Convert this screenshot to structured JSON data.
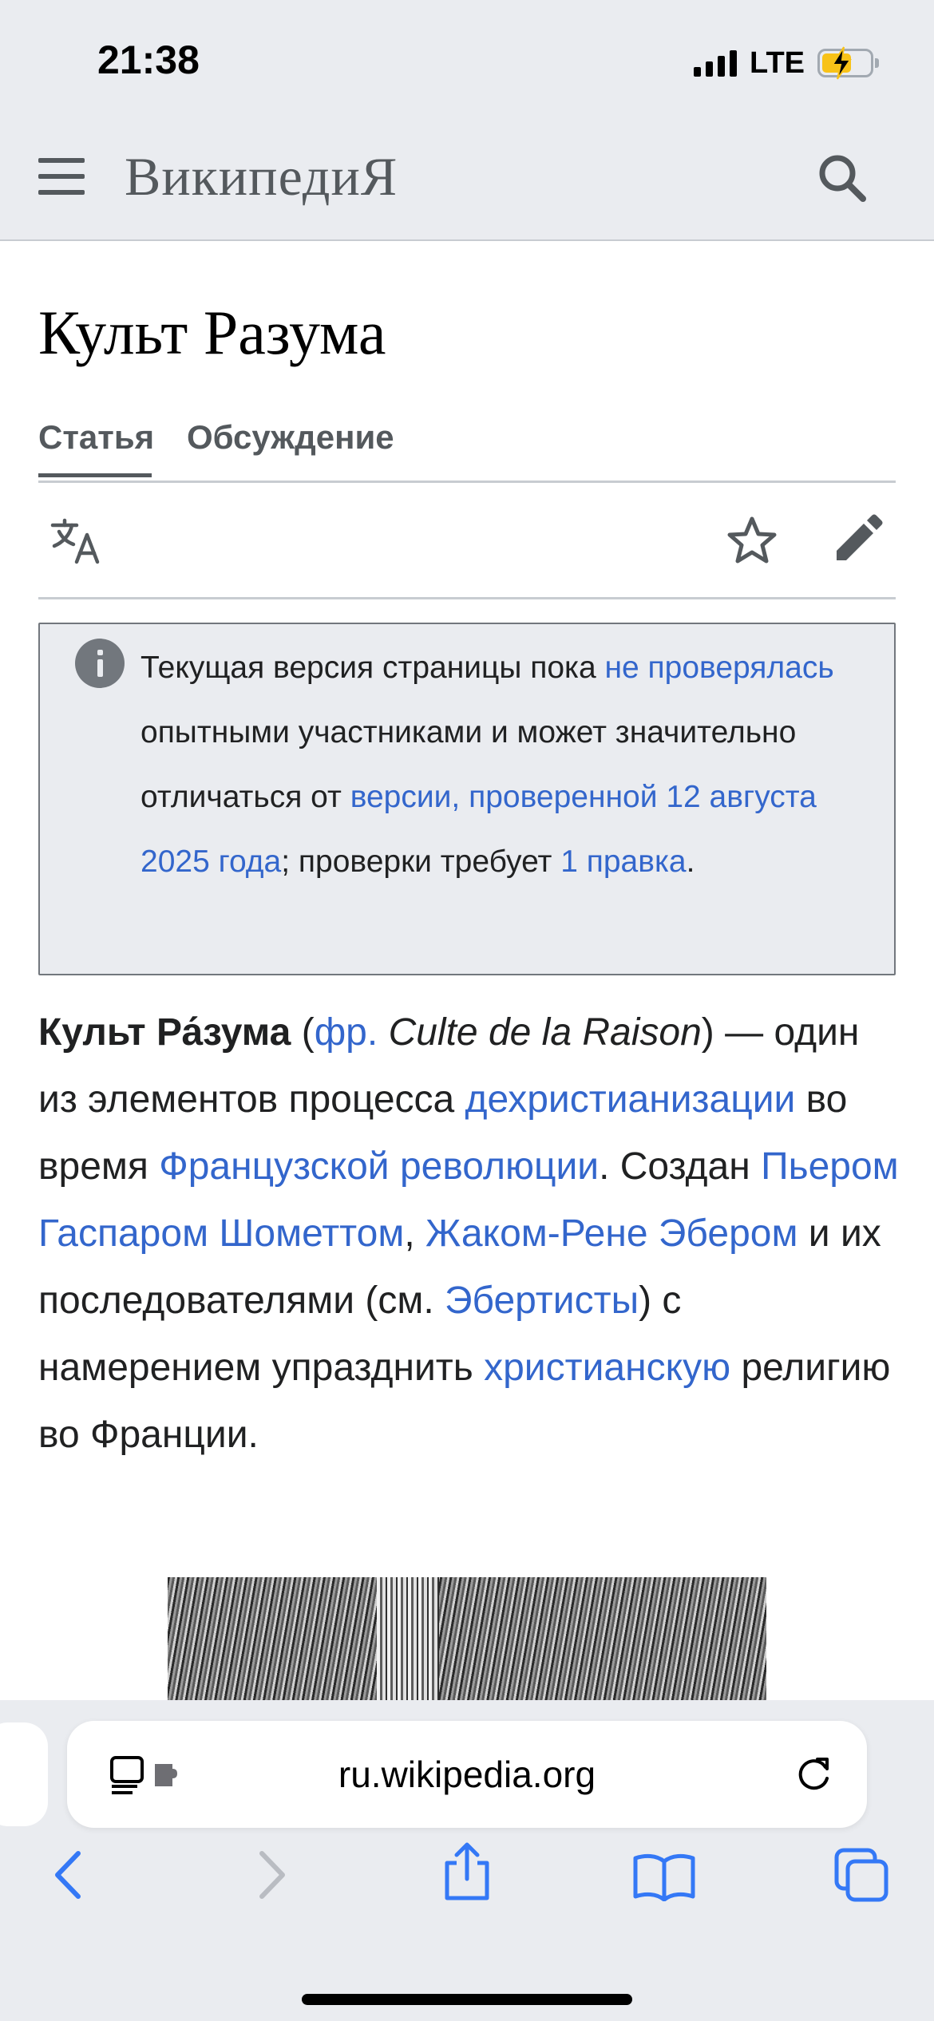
{
  "status": {
    "time": "21:38",
    "network": "LTE"
  },
  "header": {
    "wordmark": "ВикипедиЯ"
  },
  "article": {
    "title": "Культ Разума",
    "tabs": [
      "Статья",
      "Обсуждение"
    ]
  },
  "notice": {
    "t1": "Текущая версия страницы пока ",
    "link1": "не проверялась",
    "t2": " опытными участниками и может значительно отличаться от ",
    "link2": "версии, проверенной 12 августа 2025 года",
    "t3": "; проверки требует ",
    "link3": "1 правка",
    "t4": "."
  },
  "lead": {
    "bold": "Культ Ра́зума",
    "p1": " (",
    "lang_link": "фр.",
    "p2": " ",
    "italic": "Culte de la Raison",
    "p3": ") — один из элементов процесса ",
    "l1": "дехристианизации",
    "p4": " во время ",
    "l2": "Французской революции",
    "p5": ". Создан ",
    "l3": "Пьером Гаспаром Шометтом",
    "p6": ", ",
    "l4": "Жаком-Рене Эбером",
    "p7": " и их последователями (см. ",
    "l5": "Эбертисты",
    "p8": ") с намерением упразднить ",
    "l6": "христианскую",
    "p9": " религию во Франции."
  },
  "browser": {
    "url": "ru.wikipedia.org"
  },
  "colors": {
    "link": "#3366cc",
    "header_bg": "#eaecf0",
    "battery": "#f8c218"
  }
}
